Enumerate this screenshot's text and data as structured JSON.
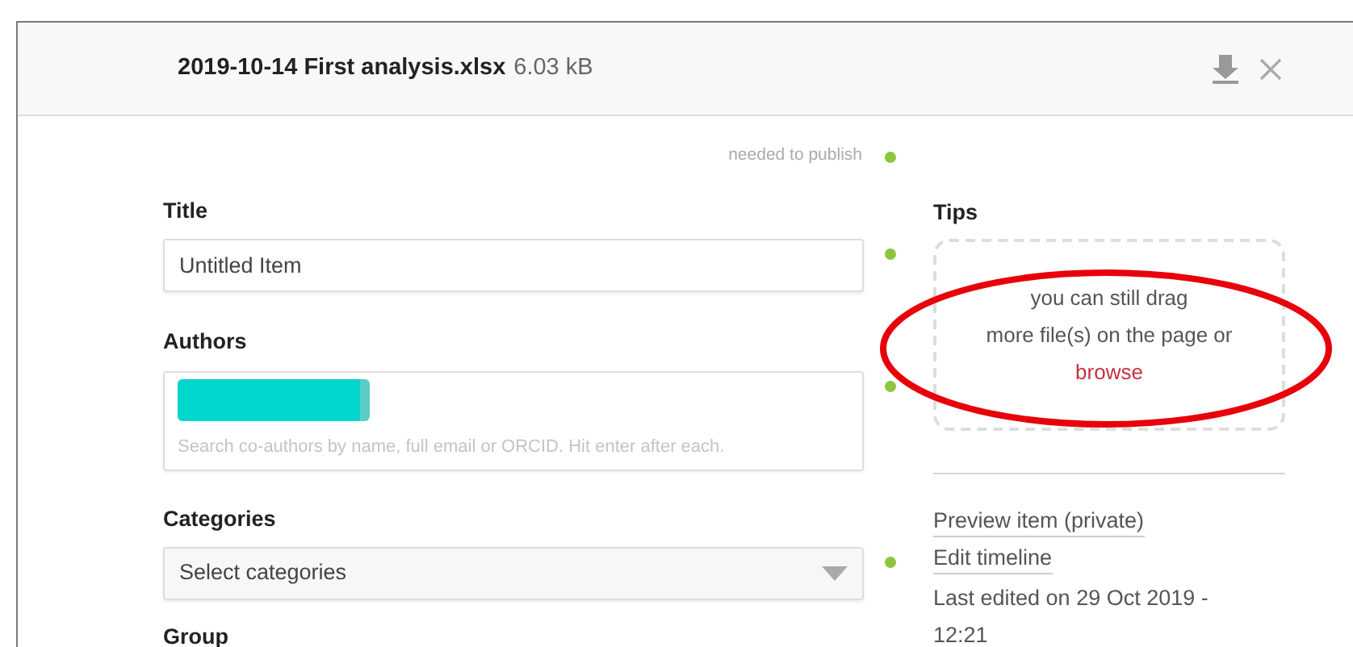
{
  "header": {
    "file_name": "2019-10-14 First analysis.xlsx",
    "file_size": "6.03 kB"
  },
  "required_legend": "needed to publish",
  "fields": [
    {
      "kind": "text",
      "label": "Title",
      "value": "Untitled Item",
      "required": true
    },
    {
      "kind": "authors",
      "label": "Authors",
      "placeholder": "Search co-authors by name, full email or ORCID. Hit enter after each.",
      "required": true
    },
    {
      "kind": "select",
      "label": "Categories",
      "value": "Select categories",
      "required": true
    },
    {
      "kind": "label",
      "label": "Group"
    }
  ],
  "tips": {
    "title": "Tips",
    "lines": [
      "you can still drag",
      "more file(s) on the page or"
    ],
    "link": "browse"
  },
  "links": [
    "Preview item (private)",
    "Edit timeline"
  ],
  "last_edited": "Last edited on 29 Oct 2019 - 12:21",
  "annotation": {
    "kind": "ellipse",
    "color": "#e8000b"
  }
}
